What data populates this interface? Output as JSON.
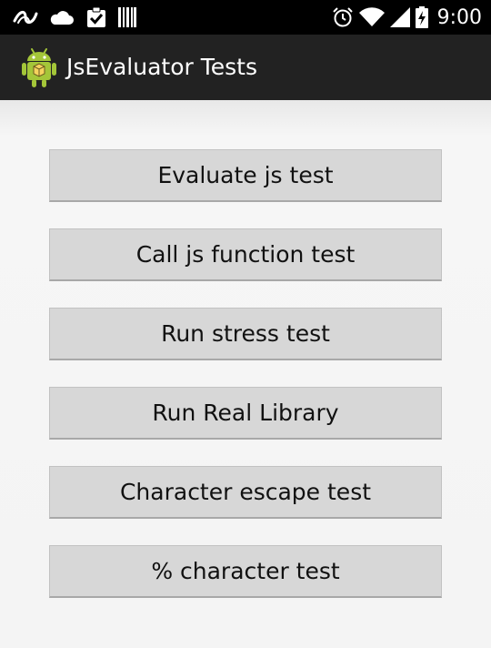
{
  "status_bar": {
    "time": "9:00",
    "left_icons": [
      "swype-icon",
      "cloud-icon",
      "clipboard-check-icon",
      "barcode-icon"
    ],
    "right_icons": [
      "alarm-icon",
      "wifi-icon",
      "cell-signal-icon",
      "battery-charging-icon"
    ]
  },
  "action_bar": {
    "title": "JsEvaluator Tests",
    "icon": "android-icon",
    "background": "#222222"
  },
  "buttons": [
    {
      "label": "Evaluate js test"
    },
    {
      "label": "Call js function test"
    },
    {
      "label": "Run stress test"
    },
    {
      "label": "Run Real Library"
    },
    {
      "label": "Character escape test"
    },
    {
      "label": "% character test"
    }
  ]
}
